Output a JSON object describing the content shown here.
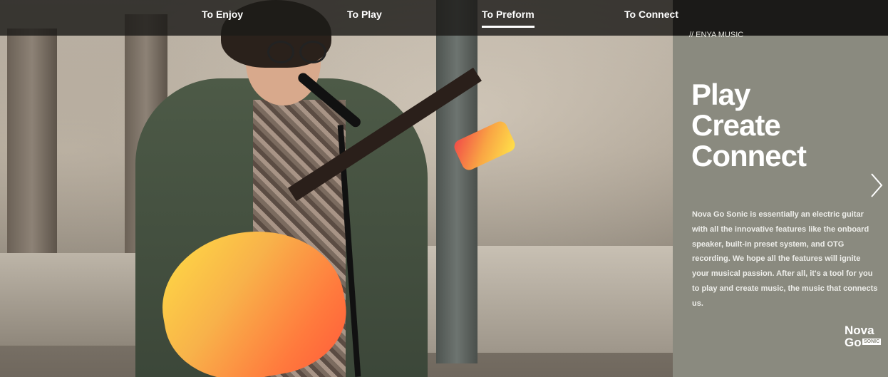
{
  "nav": {
    "items": [
      {
        "label": "To Enjoy"
      },
      {
        "label": "To Play"
      },
      {
        "label": "To Preform"
      },
      {
        "label": "To Connect"
      }
    ],
    "active_index": 2
  },
  "panel": {
    "brand": "// ENYA MUSIC",
    "hero_lines": [
      "Play",
      "Create",
      "Connect"
    ],
    "description": "Nova Go Sonic is essentially an electric guitar with all the innovative features like the onboard speaker, built-in preset system, and OTG recording. We hope all the features will ignite your musical passion. After all, it's a tool for you to play and create music, the music that connects us.",
    "logo": {
      "line1": "Nova",
      "line2": "Go",
      "badge": "SONIC"
    },
    "next_icon": "chevron-right-icon"
  },
  "colors": {
    "nav_bg": "#1c1b19",
    "panel_bg": "#8a8a7f",
    "guitar_gradient": [
      "#ffdd44",
      "#ff5a3a"
    ]
  }
}
